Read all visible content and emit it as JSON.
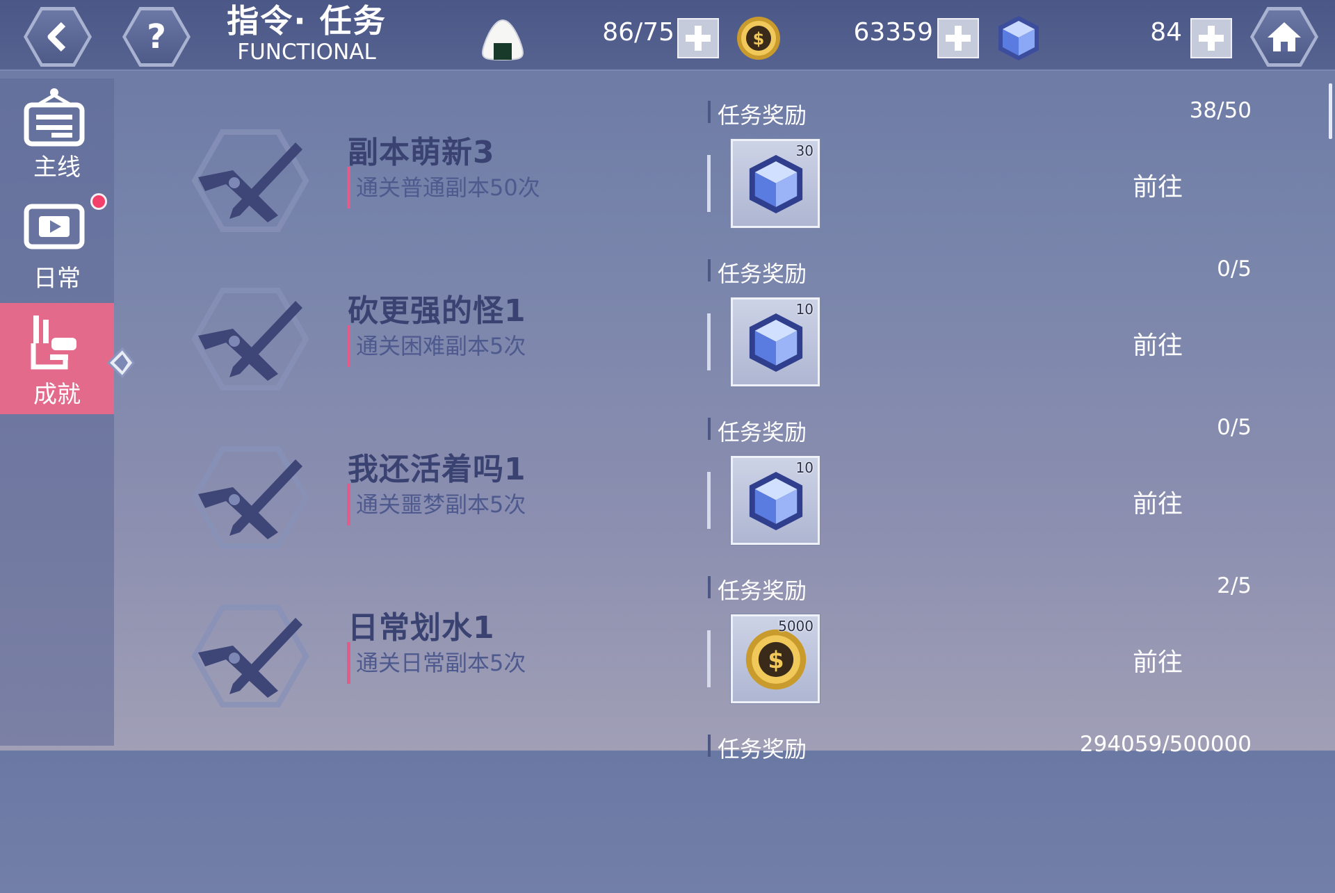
{
  "header": {
    "title_cn": "指令· 任务",
    "title_en": "FUNCTIONAL",
    "stamina": "86/75",
    "coins": "63359",
    "gems": "84"
  },
  "sidebar": {
    "items": [
      {
        "label": "主线"
      },
      {
        "label": "日常"
      },
      {
        "label": "成就"
      }
    ]
  },
  "tasks": [
    {
      "name": "副本萌新3",
      "desc": "通关普通副本50次",
      "reward_label": "任务奖励",
      "progress": "38/50",
      "reward_icon": "gem-icon",
      "reward_count": "30",
      "action": "前往"
    },
    {
      "name": "砍更强的怪1",
      "desc": "通关困难副本5次",
      "reward_label": "任务奖励",
      "progress": "0/5",
      "reward_icon": "gem-icon",
      "reward_count": "10",
      "action": "前往"
    },
    {
      "name": "我还活着吗1",
      "desc": "通关噩梦副本5次",
      "reward_label": "任务奖励",
      "progress": "0/5",
      "reward_icon": "gem-icon",
      "reward_count": "10",
      "action": "前往"
    },
    {
      "name": "日常划水1",
      "desc": "通关日常副本5次",
      "reward_label": "任务奖励",
      "progress": "2/5",
      "reward_icon": "coin-icon",
      "reward_count": "5000",
      "action": "前往"
    },
    {
      "name": "",
      "desc": "",
      "reward_label": "任务奖励",
      "progress": "294059/500000",
      "reward_icon": "",
      "reward_count": "",
      "action": ""
    }
  ],
  "colors": {
    "accent_pink": "#e46a8c",
    "background": "#7985ab",
    "topbar": "#4b5787"
  }
}
